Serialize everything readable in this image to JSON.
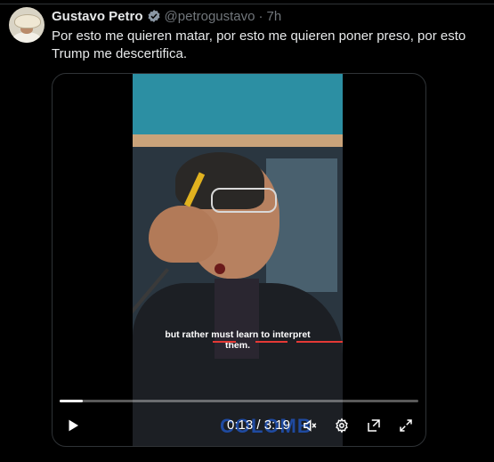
{
  "tweet": {
    "author_name": "Gustavo Petro",
    "handle": "@petrogustavo",
    "separator": "·",
    "time": "7h",
    "text": "Por esto me quieren matar, por esto me quieren poner preso, por esto Trump me descertifica."
  },
  "video": {
    "caption_line1": "but rather must learn to interpret",
    "caption_line2": "them.",
    "banner_text": "COLOMB",
    "current_time": "0:13",
    "time_separator": "/",
    "duration": "3:19",
    "progress_fraction": 0.065
  },
  "icons": {
    "verified": "verified-badge-icon",
    "play": "play-icon",
    "mute": "mute-icon",
    "settings": "gear-icon",
    "popout": "popout-icon",
    "fullscreen": "fullscreen-icon"
  },
  "colors": {
    "background": "#000000",
    "text_primary": "#e7e9ea",
    "text_secondary": "#71767b",
    "verified": "#8b98a5",
    "caption_accent": "#e53935"
  }
}
